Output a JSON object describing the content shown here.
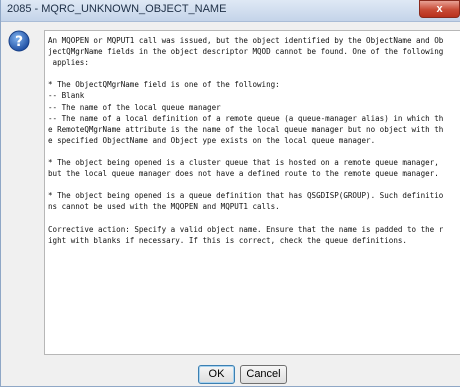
{
  "window": {
    "title": "2085 - MQRC_UNKNOWN_OBJECT_NAME",
    "close_label": "x"
  },
  "message": {
    "icon": "question-icon",
    "lines": [
      "An MQOPEN or MQPUT1 call was issued, but the object identified by the ObjectName and Ob",
      "jectQMgrName fields in the object descriptor MQOD cannot be found. One of the following",
      " applies:",
      "",
      "* The ObjectQMgrName field is one of the following:",
      "-- Blank",
      "-- The name of the local queue manager",
      "-- The name of a local definition of a remote queue (a queue-manager alias) in which th",
      "e RemoteQMgrName attribute is the name of the local queue manager but no object with th",
      "e specified ObjectName and Object ype exists on the local queue manager.",
      "",
      "* The object being opened is a cluster queue that is hosted on a remote queue manager,",
      "but the local queue manager does not have a defined route to the remote queue manager.",
      "",
      "* The object being opened is a queue definition that has QSGDISP(GROUP). Such definitio",
      "ns cannot be used with the MQOPEN and MQPUT1 calls.",
      "",
      "Corrective action: Specify a valid object name. Ensure that the name is padded to the r",
      "ight with blanks if necessary. If this is correct, check the queue definitions."
    ]
  },
  "buttons": {
    "ok_label": "OK",
    "cancel_label": "Cancel"
  },
  "colors": {
    "titlebar": "#c4d4e9",
    "close_button": "#c84a35",
    "help_icon": "#2a5fb4"
  }
}
